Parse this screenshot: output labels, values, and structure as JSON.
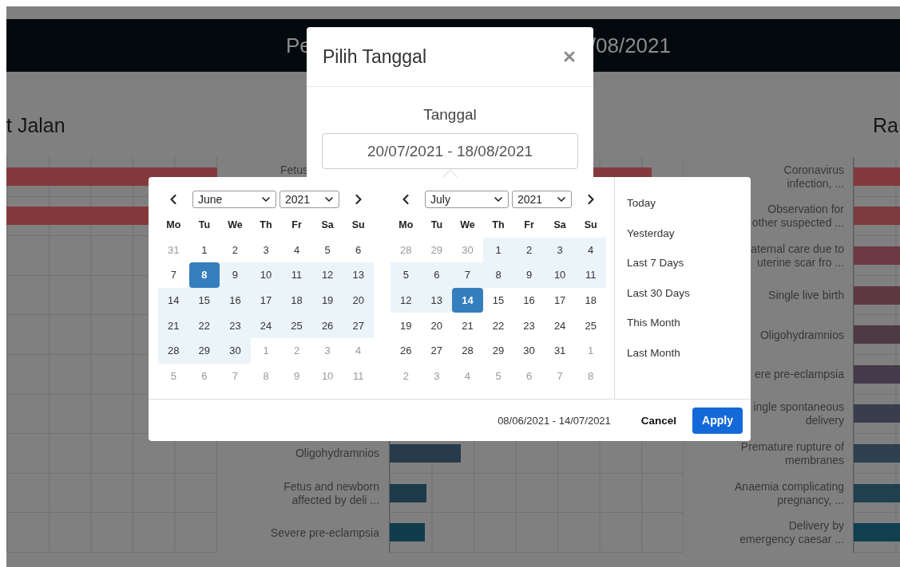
{
  "header": {
    "title_parts": [
      "Pe",
      "/08/2021"
    ]
  },
  "left_chart": {
    "title": "t Jalan"
  },
  "middle_chart": {
    "top_row_label": "Fetus",
    "bottom_rows": [
      {
        "label": "Oligohydramnios"
      },
      {
        "label": "Fetus and newborn\naffected by deli ..."
      },
      {
        "label": "Severe pre-eclampsia"
      }
    ]
  },
  "right_chart": {
    "title": "Ra",
    "rows": [
      {
        "label": "Coronavirus\ninfection, ..."
      },
      {
        "label": "Observation for\nother suspected ..."
      },
      {
        "label": "aternal care due to\nuterine scar fro ..."
      },
      {
        "label": "Single live birth"
      },
      {
        "label": "Oligohydramnios"
      },
      {
        "label": "ere pre-eclampsia"
      },
      {
        "label": "ingle spontaneous\ndelivery"
      },
      {
        "label": "Premature rupture of\nmembranes"
      },
      {
        "label": "Anaemia complicating\npregnancy, ..."
      },
      {
        "label": "Delivery by\nemergency caesar ..."
      }
    ]
  },
  "modal": {
    "title": "Pilih Tanggal",
    "field_label": "Tanggal",
    "value": "20/07/2021 - 18/08/2021"
  },
  "picker": {
    "calendars": [
      {
        "month": "June",
        "year": "2021",
        "weekdays": [
          "Mo",
          "Tu",
          "We",
          "Th",
          "Fr",
          "Sa",
          "Su"
        ],
        "weeks": [
          [
            {
              "d": "31",
              "kind": "off"
            },
            {
              "d": "1",
              "kind": "day"
            },
            {
              "d": "2",
              "kind": "day"
            },
            {
              "d": "3",
              "kind": "day"
            },
            {
              "d": "4",
              "kind": "day"
            },
            {
              "d": "5",
              "kind": "day"
            },
            {
              "d": "6",
              "kind": "day"
            }
          ],
          [
            {
              "d": "7",
              "kind": "day"
            },
            {
              "d": "8",
              "kind": "start"
            },
            {
              "d": "9",
              "kind": "range"
            },
            {
              "d": "10",
              "kind": "range"
            },
            {
              "d": "11",
              "kind": "range"
            },
            {
              "d": "12",
              "kind": "range"
            },
            {
              "d": "13",
              "kind": "range"
            }
          ],
          [
            {
              "d": "14",
              "kind": "range"
            },
            {
              "d": "15",
              "kind": "range"
            },
            {
              "d": "16",
              "kind": "range"
            },
            {
              "d": "17",
              "kind": "range"
            },
            {
              "d": "18",
              "kind": "range"
            },
            {
              "d": "19",
              "kind": "range"
            },
            {
              "d": "20",
              "kind": "range"
            }
          ],
          [
            {
              "d": "21",
              "kind": "range"
            },
            {
              "d": "22",
              "kind": "range"
            },
            {
              "d": "23",
              "kind": "range"
            },
            {
              "d": "24",
              "kind": "range"
            },
            {
              "d": "25",
              "kind": "range"
            },
            {
              "d": "26",
              "kind": "range"
            },
            {
              "d": "27",
              "kind": "range"
            }
          ],
          [
            {
              "d": "28",
              "kind": "range"
            },
            {
              "d": "29",
              "kind": "range"
            },
            {
              "d": "30",
              "kind": "range"
            },
            {
              "d": "1",
              "kind": "off"
            },
            {
              "d": "2",
              "kind": "off"
            },
            {
              "d": "3",
              "kind": "off"
            },
            {
              "d": "4",
              "kind": "off"
            }
          ],
          [
            {
              "d": "5",
              "kind": "off"
            },
            {
              "d": "6",
              "kind": "off"
            },
            {
              "d": "7",
              "kind": "off"
            },
            {
              "d": "8",
              "kind": "off"
            },
            {
              "d": "9",
              "kind": "off"
            },
            {
              "d": "10",
              "kind": "off"
            },
            {
              "d": "11",
              "kind": "off"
            }
          ]
        ]
      },
      {
        "month": "July",
        "year": "2021",
        "weekdays": [
          "Mo",
          "Tu",
          "We",
          "Th",
          "Fr",
          "Sa",
          "Su"
        ],
        "weeks": [
          [
            {
              "d": "28",
              "kind": "off"
            },
            {
              "d": "29",
              "kind": "off"
            },
            {
              "d": "30",
              "kind": "off"
            },
            {
              "d": "1",
              "kind": "range"
            },
            {
              "d": "2",
              "kind": "range"
            },
            {
              "d": "3",
              "kind": "range"
            },
            {
              "d": "4",
              "kind": "range"
            }
          ],
          [
            {
              "d": "5",
              "kind": "range"
            },
            {
              "d": "6",
              "kind": "range"
            },
            {
              "d": "7",
              "kind": "range"
            },
            {
              "d": "8",
              "kind": "range"
            },
            {
              "d": "9",
              "kind": "range"
            },
            {
              "d": "10",
              "kind": "range"
            },
            {
              "d": "11",
              "kind": "range"
            }
          ],
          [
            {
              "d": "12",
              "kind": "range"
            },
            {
              "d": "13",
              "kind": "range"
            },
            {
              "d": "14",
              "kind": "end"
            },
            {
              "d": "15",
              "kind": "day"
            },
            {
              "d": "16",
              "kind": "day"
            },
            {
              "d": "17",
              "kind": "day"
            },
            {
              "d": "18",
              "kind": "day"
            }
          ],
          [
            {
              "d": "19",
              "kind": "day"
            },
            {
              "d": "20",
              "kind": "day"
            },
            {
              "d": "21",
              "kind": "day"
            },
            {
              "d": "22",
              "kind": "day"
            },
            {
              "d": "23",
              "kind": "day"
            },
            {
              "d": "24",
              "kind": "day"
            },
            {
              "d": "25",
              "kind": "day"
            }
          ],
          [
            {
              "d": "26",
              "kind": "day"
            },
            {
              "d": "27",
              "kind": "day"
            },
            {
              "d": "28",
              "kind": "day"
            },
            {
              "d": "29",
              "kind": "day"
            },
            {
              "d": "30",
              "kind": "day"
            },
            {
              "d": "31",
              "kind": "day"
            },
            {
              "d": "1",
              "kind": "off"
            }
          ],
          [
            {
              "d": "2",
              "kind": "off"
            },
            {
              "d": "3",
              "kind": "off"
            },
            {
              "d": "4",
              "kind": "off"
            },
            {
              "d": "5",
              "kind": "off"
            },
            {
              "d": "6",
              "kind": "off"
            },
            {
              "d": "7",
              "kind": "off"
            },
            {
              "d": "8",
              "kind": "off"
            }
          ]
        ]
      }
    ],
    "ranges": [
      {
        "label": "Today",
        "selected": false
      },
      {
        "label": "Yesterday",
        "selected": false
      },
      {
        "label": "Last 7 Days",
        "selected": false
      },
      {
        "label": "Last 30 Days",
        "selected": false
      },
      {
        "label": "This Month",
        "selected": false
      },
      {
        "label": "Last Month",
        "selected": false
      }
    ],
    "selected_range": "08/06/2021 - 14/07/2021",
    "cancel": "Cancel",
    "apply": "Apply"
  }
}
